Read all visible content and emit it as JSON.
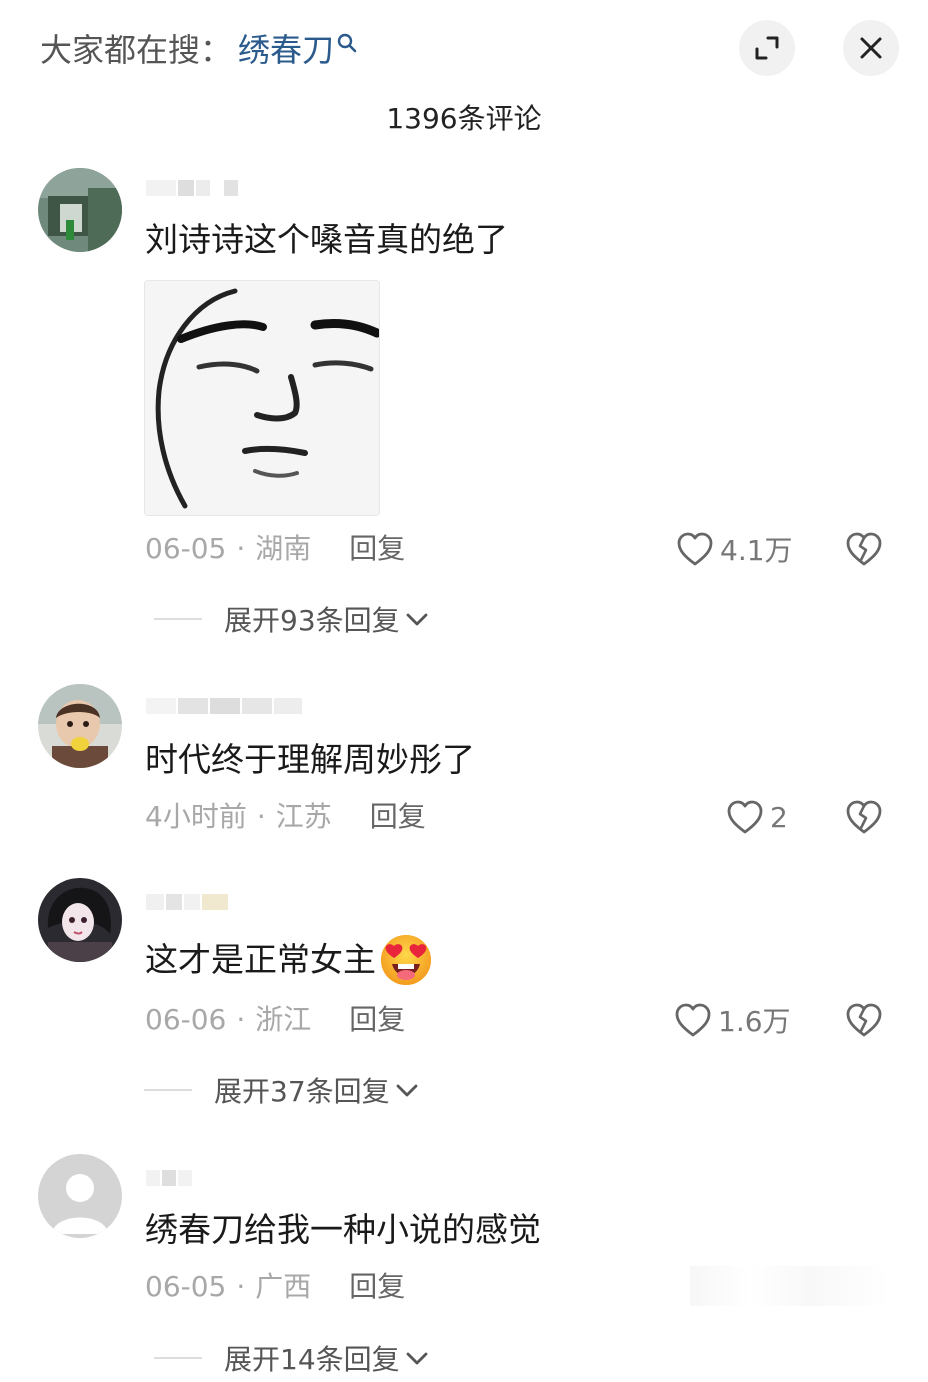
{
  "header": {
    "search_prefix": "大家都在搜：",
    "search_keyword": "绣春刀",
    "search_icon": "search-icon",
    "expand_icon": "collapse-expand-icon",
    "close_icon": "close-icon",
    "comment_count": "1396条评论"
  },
  "comments": [
    {
      "text": "刘诗诗这个嗓音真的绝了",
      "has_sticker": true,
      "date": "06-05",
      "sep": "·",
      "location": "湖南",
      "reply": "回复",
      "likes": "4.1万",
      "expand": "展开93条回复"
    },
    {
      "text": "时代终于理解周妙彤了",
      "date": "4小时前",
      "sep": "·",
      "location": "江苏",
      "reply": "回复",
      "likes": "2"
    },
    {
      "text": "这才是正常女主",
      "emoji": "heart-eyes-emoji",
      "date": "06-06",
      "sep": "·",
      "location": "浙江",
      "reply": "回复",
      "likes": "1.6万",
      "expand": "展开37条回复"
    },
    {
      "text": "绣春刀给我一种小说的感觉",
      "date": "06-05",
      "sep": "·",
      "location": "广西",
      "reply": "回复",
      "expand": "展开14条回复"
    }
  ],
  "colors": {
    "keyword": "#2b5a8c",
    "meta": "#a8a8a8",
    "text": "#1a1a1a"
  }
}
